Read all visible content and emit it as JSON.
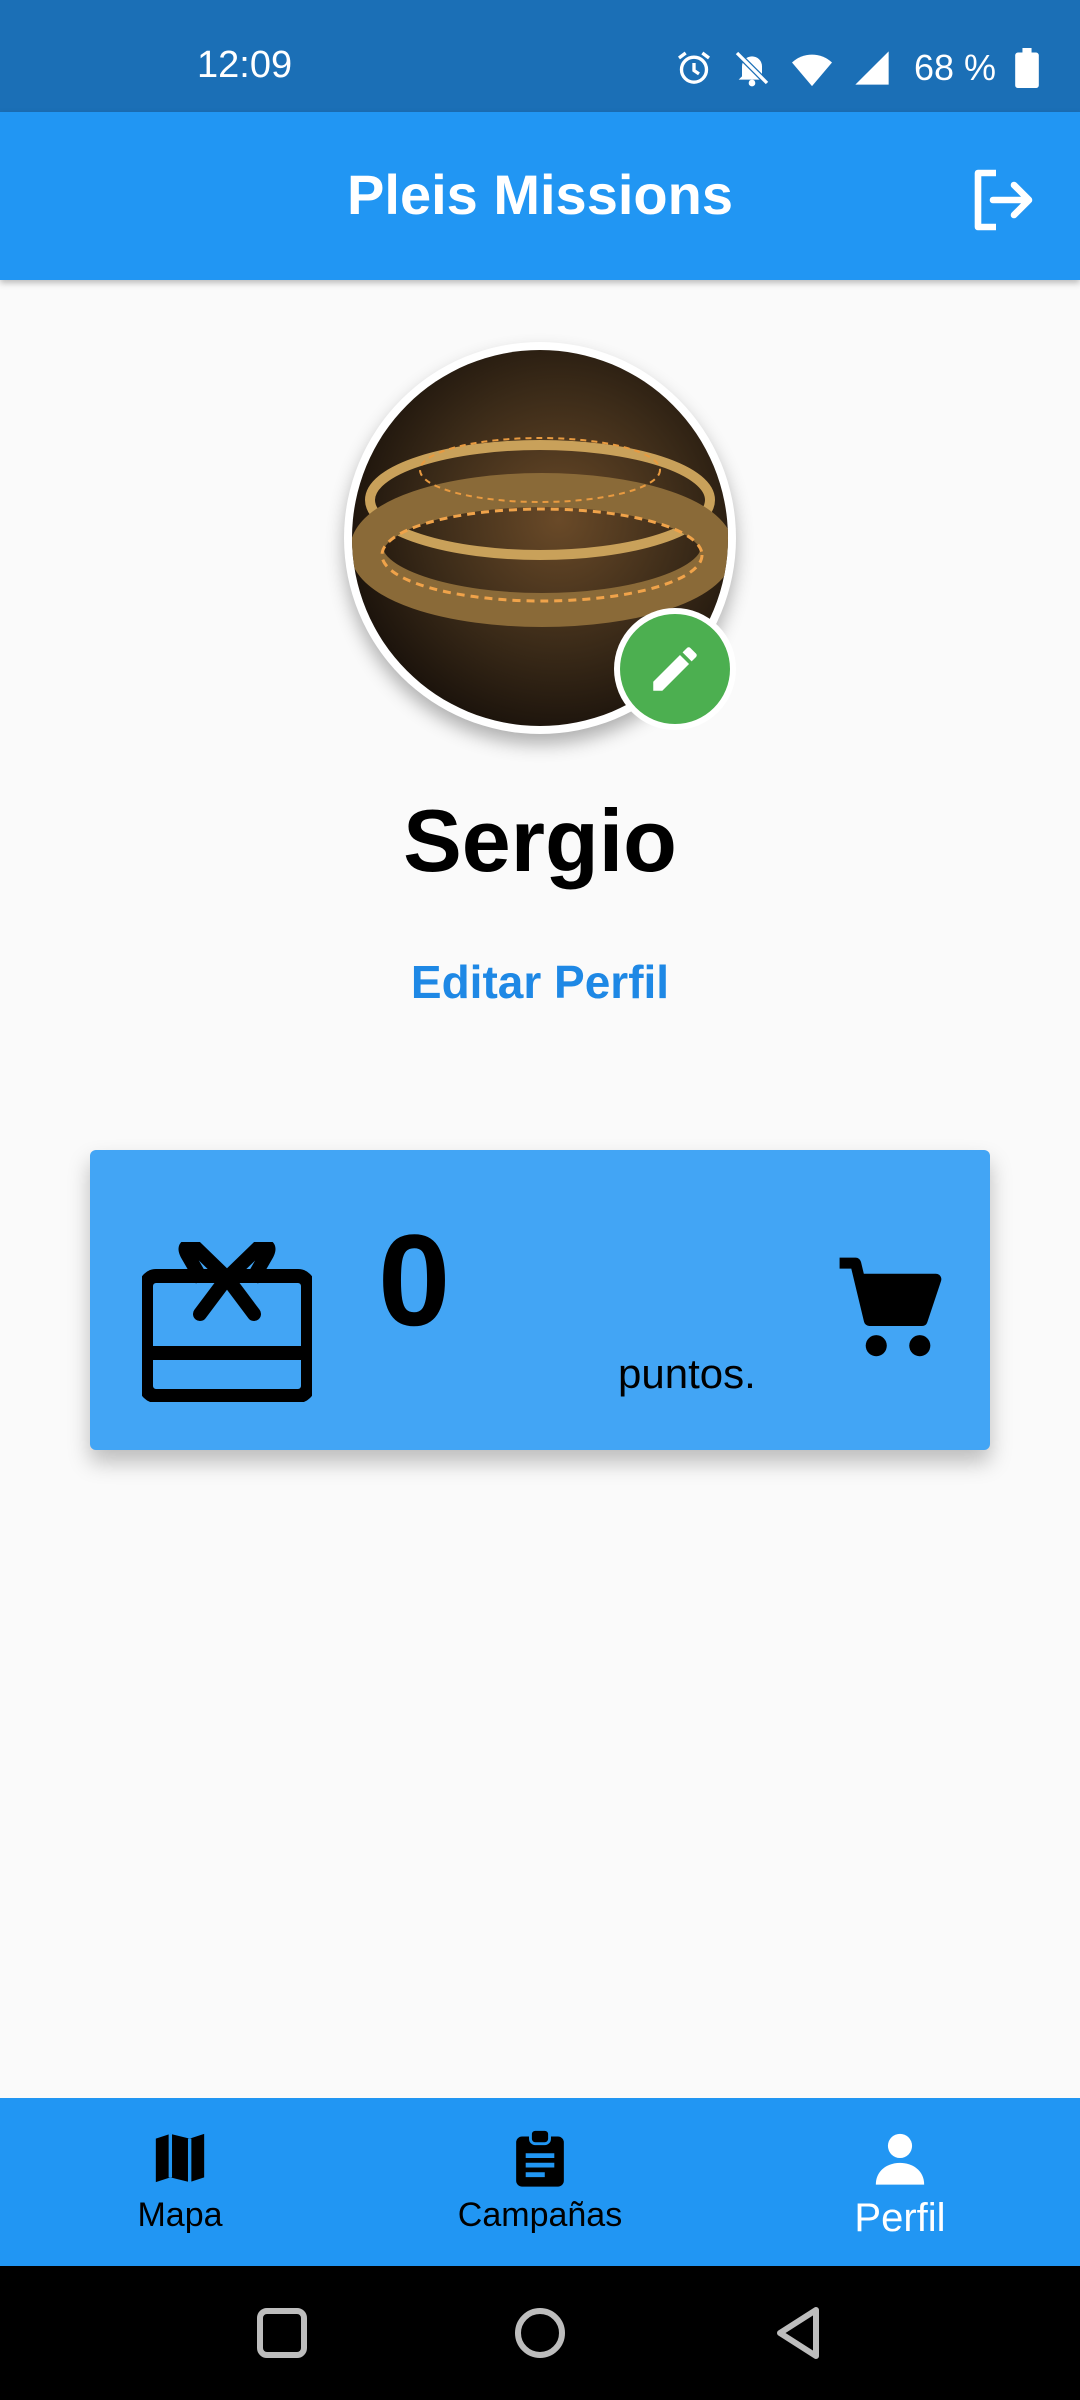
{
  "status_bar": {
    "time": "12:09",
    "battery": "68 %",
    "icons": [
      "alarm-icon",
      "notifications-off-icon",
      "wifi-icon",
      "signal-icon",
      "battery-icon"
    ]
  },
  "app_bar": {
    "title": "Pleis Missions",
    "logout_icon": "logout-icon"
  },
  "profile": {
    "name": "Sergio",
    "edit_profile_label": "Editar Perfil",
    "avatar_edit_icon": "pencil-icon"
  },
  "points_card": {
    "value": "0",
    "unit": "puntos.",
    "left_icon": "gift-card-icon",
    "right_icon": "shopping-cart-icon"
  },
  "bottom_nav": {
    "items": [
      {
        "label": "Mapa",
        "icon": "map-icon",
        "active": false
      },
      {
        "label": "Campañas",
        "icon": "clipboard-icon",
        "active": false
      },
      {
        "label": "Perfil",
        "icon": "person-icon",
        "active": true
      }
    ]
  },
  "system_nav": {
    "buttons": [
      "recents-icon",
      "home-icon",
      "back-icon"
    ]
  },
  "colors": {
    "status_bar": "#1b6fb6",
    "primary": "#2196f3",
    "card": "#42a5f5",
    "link": "#1e88e5",
    "edit_badge": "#4caf50",
    "background": "#fafafa"
  }
}
